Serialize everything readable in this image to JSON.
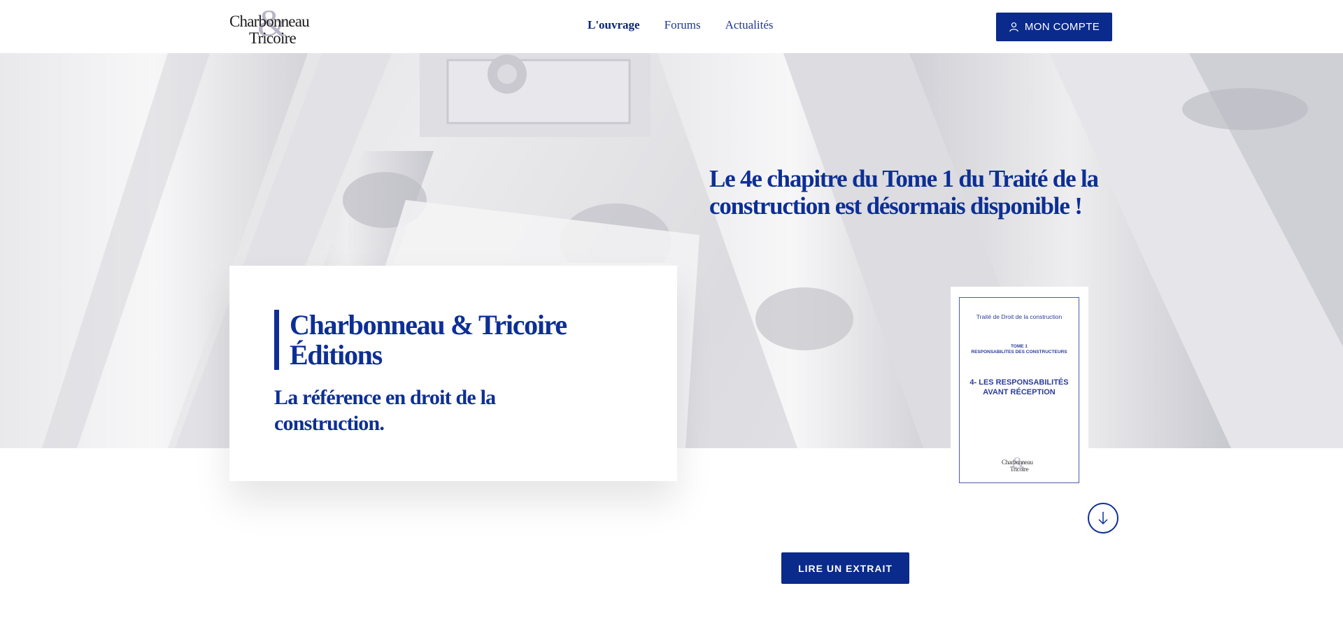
{
  "brand": {
    "logo_line1": "Charbonneau",
    "logo_amp": "&",
    "logo_line2": "Tricoire"
  },
  "nav": {
    "items": [
      {
        "label": "L'ouvrage",
        "active": true
      },
      {
        "label": "Forums",
        "active": false
      },
      {
        "label": "Actualités",
        "active": false
      }
    ]
  },
  "header": {
    "account_label": "MON COMPTE",
    "account_icon": "user-icon"
  },
  "hero": {
    "headline": "Le 4e chapitre du Tome 1 du Traité de la construction est désormais disponible !",
    "card_title_line1": "Charbonneau & Tricoire",
    "card_title_line2": "Éditions",
    "card_subtitle": "La référence en droit de la construction."
  },
  "book": {
    "series": "Traité de Droit de la construction",
    "tome_line1": "TOME 1",
    "tome_line2": "RESPONSABILITES DES CONSTRUCTEURS",
    "chapter_line1": "4- LES RESPONSABILITÉS",
    "chapter_line2": "AVANT RÉCEPTION",
    "logo_line1": "Charbonneau",
    "logo_line2": "Tricoire"
  },
  "actions": {
    "scroll_icon": "arrow-down-icon",
    "extract_label": "LIRE UN EXTRAIT"
  },
  "colors": {
    "brand_blue": "#0a2a8c",
    "text_blue": "#0d2f95"
  }
}
